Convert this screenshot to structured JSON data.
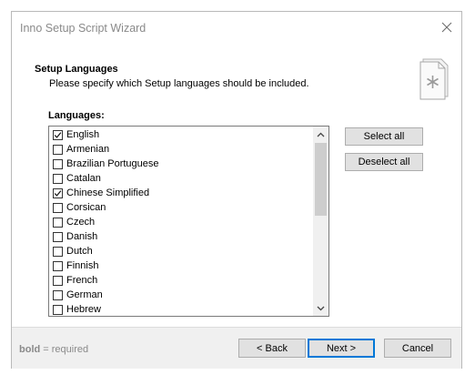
{
  "window": {
    "title": "Inno Setup Script Wizard"
  },
  "header": {
    "title": "Setup Languages",
    "subtitle": "Please specify which Setup languages should be included."
  },
  "languages_label": "Languages:",
  "languages": [
    {
      "label": "English",
      "checked": true
    },
    {
      "label": "Armenian",
      "checked": false
    },
    {
      "label": "Brazilian Portuguese",
      "checked": false
    },
    {
      "label": "Catalan",
      "checked": false
    },
    {
      "label": "Chinese Simplified",
      "checked": true
    },
    {
      "label": "Corsican",
      "checked": false
    },
    {
      "label": "Czech",
      "checked": false
    },
    {
      "label": "Danish",
      "checked": false
    },
    {
      "label": "Dutch",
      "checked": false
    },
    {
      "label": "Finnish",
      "checked": false
    },
    {
      "label": "French",
      "checked": false
    },
    {
      "label": "German",
      "checked": false
    },
    {
      "label": "Hebrew",
      "checked": false
    }
  ],
  "buttons": {
    "select_all": "Select all",
    "deselect_all": "Deselect all",
    "back": "< Back",
    "next": "Next >",
    "cancel": "Cancel"
  },
  "footer": {
    "hint_bold": "bold",
    "hint_rest": " = required"
  },
  "colors": {
    "accent": "#0078d7",
    "button_face": "#e1e1e1",
    "footer_bg": "#f0f0f0"
  },
  "icons": {
    "close": "close-icon",
    "header": "document-asterisk-icon",
    "check": "checkmark-icon",
    "scroll_up": "chevron-up-icon",
    "scroll_down": "chevron-down-icon"
  }
}
